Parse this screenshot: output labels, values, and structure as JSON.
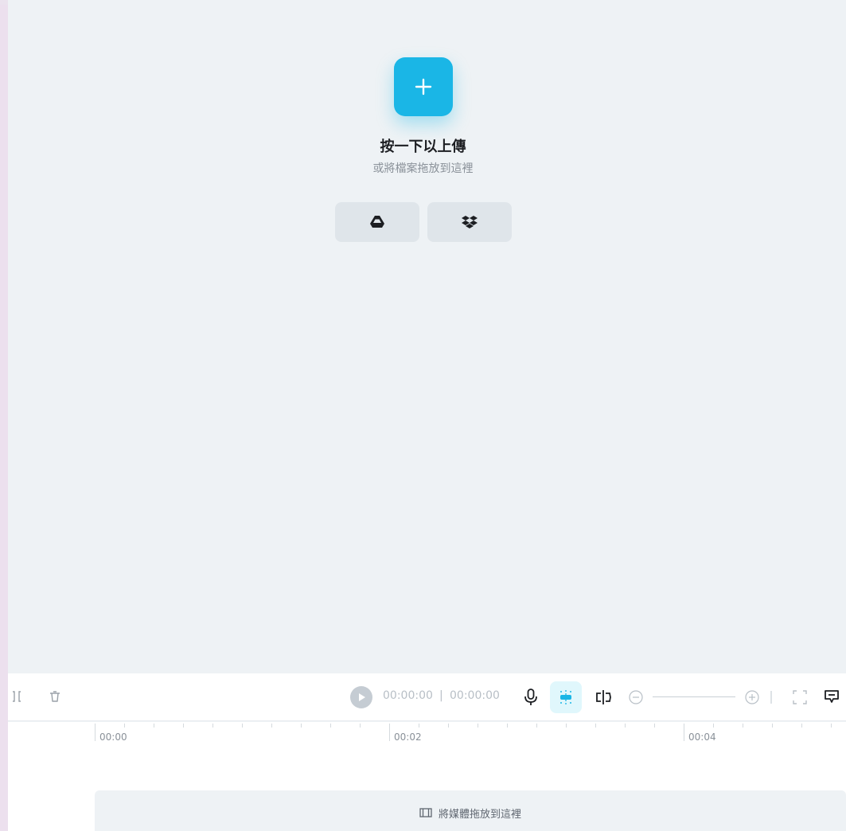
{
  "upload": {
    "title": "按一下以上傳",
    "subtitle": "或將檔案拖放到這裡"
  },
  "cloud_buttons": [
    {
      "icon": "google-drive-icon"
    },
    {
      "icon": "dropbox-icon"
    }
  ],
  "toolbar": {
    "current_time": "00:00:00",
    "separator": "|",
    "total_time": "00:00:00"
  },
  "timeline": {
    "ruler_labels": [
      "00:00",
      "00:02",
      "00:04"
    ],
    "drop_text": "將媒體拖放到這裡"
  },
  "colors": {
    "accent": "#1ab6e6",
    "canvas_bg": "#eef2f5",
    "button_bg": "#dfe5ea"
  }
}
